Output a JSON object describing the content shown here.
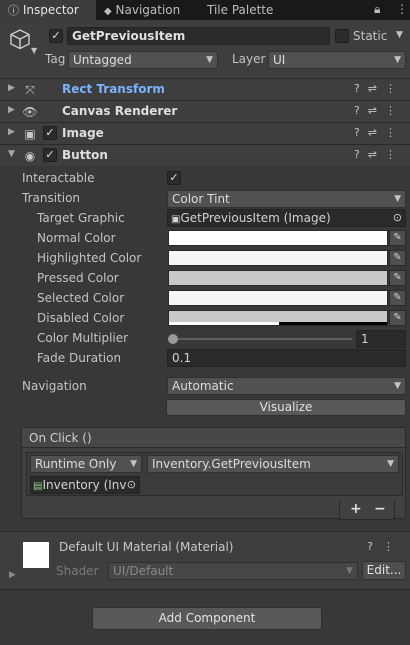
{
  "tabs": {
    "inspector": "Inspector",
    "navigation": "Navigation",
    "tile_palette": "Tile Palette"
  },
  "object": {
    "name": "GetPreviousItem",
    "static_label": "Static",
    "tag_label": "Tag",
    "tag_value": "Untagged",
    "layer_label": "Layer",
    "layer_value": "UI"
  },
  "components": {
    "rect_transform": "Rect Transform",
    "canvas_renderer": "Canvas Renderer",
    "image": "Image",
    "button": "Button"
  },
  "button": {
    "interactable_label": "Interactable",
    "transition_label": "Transition",
    "transition_value": "Color Tint",
    "target_graphic_label": "Target Graphic",
    "target_graphic_value": "GetPreviousItem (Image)",
    "normal_color_label": "Normal Color",
    "highlighted_color_label": "Highlighted Color",
    "pressed_color_label": "Pressed Color",
    "selected_color_label": "Selected Color",
    "disabled_color_label": "Disabled Color",
    "color_multiplier_label": "Color Multiplier",
    "color_multiplier_value": "1",
    "fade_duration_label": "Fade Duration",
    "fade_duration_value": "0.1",
    "navigation_label": "Navigation",
    "navigation_value": "Automatic",
    "visualize_label": "Visualize"
  },
  "colors": {
    "normal": "#ffffff",
    "highlighted": "#f5f5f5",
    "pressed": "#c8c8c8",
    "selected": "#f5f5f5",
    "disabled": "#c8c8c8",
    "accent_link": "#7ab3ff"
  },
  "on_click": {
    "title": "On Click ()",
    "runtime_value": "Runtime Only",
    "function_value": "Inventory.GetPreviousItem",
    "object_value": "Inventory (Inv",
    "add_label": "+",
    "remove_label": "−"
  },
  "material": {
    "name": "Default UI Material (Material)",
    "shader_label": "Shader",
    "shader_value": "UI/Default",
    "edit_label": "Edit..."
  },
  "add_component_label": "Add Component"
}
